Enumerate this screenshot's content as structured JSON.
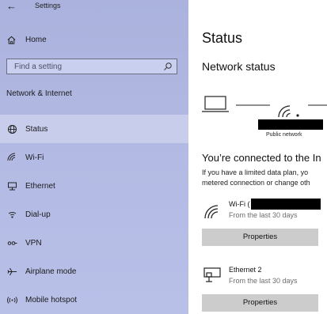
{
  "window": {
    "title": "Settings"
  },
  "sidebar": {
    "home_label": "Home",
    "search_placeholder": "Find a setting",
    "section_title": "Network & Internet",
    "items": [
      {
        "label": "Status",
        "icon": "globe-icon",
        "selected": true
      },
      {
        "label": "Wi-Fi",
        "icon": "wifi-icon"
      },
      {
        "label": "Ethernet",
        "icon": "ethernet-icon"
      },
      {
        "label": "Dial-up",
        "icon": "dialup-icon"
      },
      {
        "label": "VPN",
        "icon": "vpn-icon"
      },
      {
        "label": "Airplane mode",
        "icon": "airplane-icon"
      },
      {
        "label": "Mobile hotspot",
        "icon": "hotspot-icon"
      }
    ]
  },
  "main": {
    "page_title": "Status",
    "network_status_heading": "Network status",
    "network_label": "Public network",
    "connected_text": "You’re connected to the In",
    "limited_line1": "If you have a limited data plan, yo",
    "limited_line2": "metered connection or change oth",
    "connections": [
      {
        "name": "Wi-Fi (",
        "subtitle": "From the last 30 days",
        "button": "Properties",
        "icon": "wifi-icon"
      },
      {
        "name": "Ethernet 2",
        "subtitle": "From the last 30 days",
        "button": "Properties",
        "icon": "ethernet-icon"
      }
    ]
  },
  "colors": {
    "sidebar_bg": "#b3bbe4",
    "selected_bg": "#c8cdec",
    "button_bg": "#cccccc"
  }
}
